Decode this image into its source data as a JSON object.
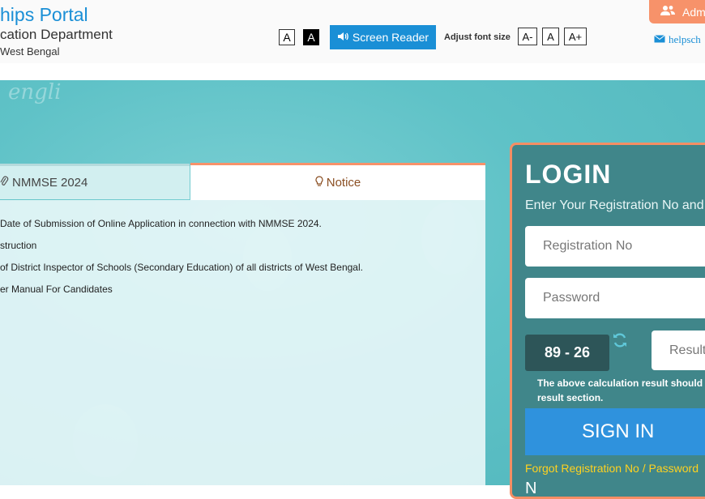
{
  "header": {
    "portal_title": "hips Portal",
    "department": "cation Department",
    "state": "West Bengal",
    "contrast_light": "A",
    "contrast_dark": "A",
    "screen_reader": "Screen Reader",
    "adjust_font_label": "Adjust font size",
    "font_decrease": "A-",
    "font_normal": "A",
    "font_increase": "A+",
    "admin_label": "Adm",
    "help_link": "helpsch"
  },
  "banner": {
    "scribble": "engli"
  },
  "tabs": [
    {
      "label": "NMMSE 2024",
      "icon": "paperclip-icon"
    },
    {
      "label": "Notice",
      "icon": "lightbulb-icon"
    }
  ],
  "notices": [
    "Date of Submission of Online Application in connection with NMMSE 2024.",
    "struction",
    "of District Inspector of Schools (Secondary Education) of all districts of West Bengal.",
    "er Manual For Candidates"
  ],
  "login": {
    "title": "LOGIN",
    "subtitle": "Enter Your Registration No and",
    "registration_placeholder": "Registration No",
    "password_placeholder": "Password",
    "captcha": "89 - 26",
    "result_placeholder": "Result",
    "calc_note": "The above calculation result should result section.",
    "signin": "SIGN IN",
    "forgot": "Forgot Registration No / Password",
    "bottom_text": "N"
  },
  "colors": {
    "brand_blue": "#1a8fd6",
    "accent_orange": "#f7926a",
    "login_teal": "#40868a",
    "link_yellow": "#ffd21f"
  }
}
